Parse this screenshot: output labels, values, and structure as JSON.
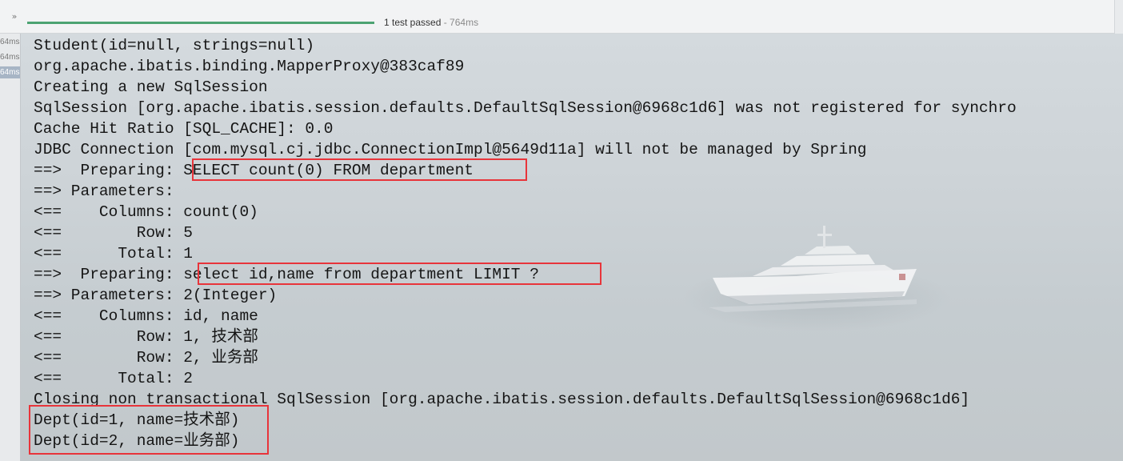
{
  "toolbar": {
    "expand_icon": "»",
    "status_text": "1 test passed",
    "status_duration": " - 764ms",
    "progress_percent": 100,
    "progress_color": "#4ca372"
  },
  "tests": [
    {
      "duration": "64ms",
      "selected": false
    },
    {
      "duration": "64ms",
      "selected": false
    },
    {
      "duration": "64ms",
      "selected": true
    }
  ],
  "console": {
    "lines": [
      "Student(id=null, strings=null)",
      "org.apache.ibatis.binding.MapperProxy@383caf89",
      "Creating a new SqlSession",
      "SqlSession [org.apache.ibatis.session.defaults.DefaultSqlSession@6968c1d6] was not registered for synchro",
      "Cache Hit Ratio [SQL_CACHE]: 0.0",
      "JDBC Connection [com.mysql.cj.jdbc.ConnectionImpl@5649d11a] will not be managed by Spring",
      "==>  Preparing: SELECT count(0) FROM department",
      "==> Parameters: ",
      "<==    Columns: count(0)",
      "<==        Row: 5",
      "<==      Total: 1",
      "==>  Preparing: select id,name from department LIMIT ?",
      "==> Parameters: 2(Integer)",
      "<==    Columns: id, name",
      "<==        Row: 1, 技术部",
      "<==        Row: 2, 业务部",
      "<==      Total: 2",
      "Closing non transactional SqlSession [org.apache.ibatis.session.defaults.DefaultSqlSession@6968c1d6]",
      "Dept(id=1, name=技术部)",
      "Dept(id=2, name=业务部)"
    ],
    "highlight_color": "#e8343a"
  }
}
